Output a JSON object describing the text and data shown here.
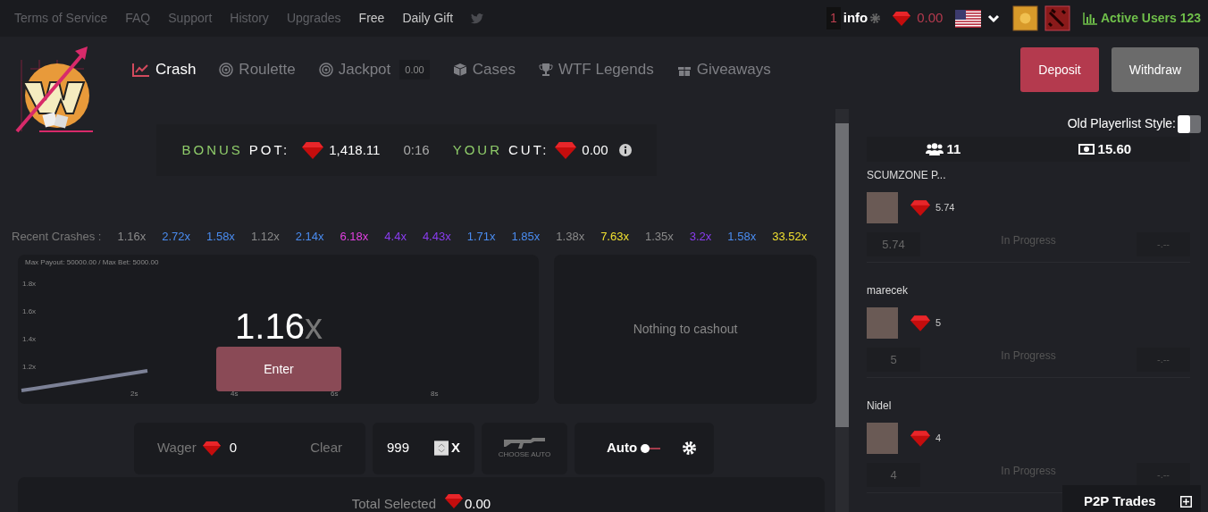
{
  "top_links": [
    {
      "label": "Terms of Service",
      "bright": false
    },
    {
      "label": "FAQ",
      "bright": false
    },
    {
      "label": "Support",
      "bright": false
    },
    {
      "label": "History",
      "bright": false
    },
    {
      "label": "Upgrades",
      "bright": false
    },
    {
      "label": "Free",
      "bright": true
    },
    {
      "label": "Daily Gift",
      "bright": true
    }
  ],
  "user_bar": {
    "notifications": "1",
    "info": "info",
    "balance": "0.00",
    "active_users": "Active Users 123"
  },
  "nav": [
    {
      "label": "Crash",
      "selected": true,
      "kind": "chart"
    },
    {
      "label": "Roulette",
      "selected": false,
      "kind": "target"
    },
    {
      "label": "Jackpot",
      "selected": false,
      "kind": "target",
      "badge": "0.00"
    },
    {
      "label": "Cases",
      "selected": false,
      "kind": "cube"
    },
    {
      "label": "WTF Legends",
      "selected": false,
      "kind": "trophy"
    },
    {
      "label": "Giveaways",
      "selected": false,
      "kind": "gift"
    }
  ],
  "buttons": {
    "deposit": "Deposit",
    "withdraw": "Withdraw"
  },
  "bonus": {
    "pot_word_1": "BONUS",
    "pot_word_2": "POT:",
    "pot": "1,418.11",
    "timer": "0:16",
    "cut_word_1": "YOUR",
    "cut_word_2": "CUT:",
    "cut": "0.00"
  },
  "recent_crashes": {
    "label": "Recent Crashes :",
    "items": [
      {
        "value": "1.16x",
        "color": "#8a8a8a"
      },
      {
        "value": "2.72x",
        "color": "#4a8cf0"
      },
      {
        "value": "1.58x",
        "color": "#4a8cf0"
      },
      {
        "value": "1.12x",
        "color": "#8a8a8a"
      },
      {
        "value": "2.14x",
        "color": "#4a8cf0"
      },
      {
        "value": "6.18x",
        "color": "#e040e0"
      },
      {
        "value": "4.4x",
        "color": "#8a3cf0"
      },
      {
        "value": "4.43x",
        "color": "#8a3cf0"
      },
      {
        "value": "1.71x",
        "color": "#4a8cf0"
      },
      {
        "value": "1.85x",
        "color": "#4a8cf0"
      },
      {
        "value": "1.38x",
        "color": "#8a8a8a"
      },
      {
        "value": "7.63x",
        "color": "#f0e030"
      },
      {
        "value": "1.35x",
        "color": "#8a8a8a"
      },
      {
        "value": "3.2x",
        "color": "#8a3cf0"
      },
      {
        "value": "1.58x",
        "color": "#4a8cf0"
      },
      {
        "value": "33.52x",
        "color": "#f0e030"
      }
    ]
  },
  "game": {
    "limits": "Max Payout: 50000.00 / Max Bet: 5000.00",
    "multiplier": "1.16",
    "multiplier_suffix": "x",
    "enter": "Enter",
    "graph_y_labels": [
      "1.8x",
      "1.6x",
      "1.4x",
      "1.2x"
    ],
    "graph_x_labels": [
      "2s",
      "4s",
      "6s",
      "8s"
    ]
  },
  "cashout": {
    "message": "Nothing to cashout"
  },
  "controls": {
    "wager_label": "Wager",
    "wager": "0",
    "clear": "Clear",
    "target": "999",
    "target_suffix": "X",
    "choose_auto": "CHOOSE AUTO",
    "auto": "Auto",
    "auto_on": false
  },
  "total": {
    "label": "Total Selected",
    "value": "0.00"
  },
  "sidebar": {
    "old_style_label": "Old Playerlist Style:",
    "old_style_on": false,
    "players_count": "11",
    "pot_total": "15.60",
    "players": [
      {
        "name": "SCUMZONE P...",
        "bet": "5.74",
        "amount": "5.74",
        "status": "In Progress",
        "cashout": "-.--"
      },
      {
        "name": "marecek",
        "bet": "5",
        "amount": "5",
        "status": "In Progress",
        "cashout": "-.--"
      },
      {
        "name": "Nidel",
        "bet": "4",
        "amount": "4",
        "status": "In Progress",
        "cashout": "-.--"
      }
    ],
    "p2p": "P2P Trades"
  }
}
